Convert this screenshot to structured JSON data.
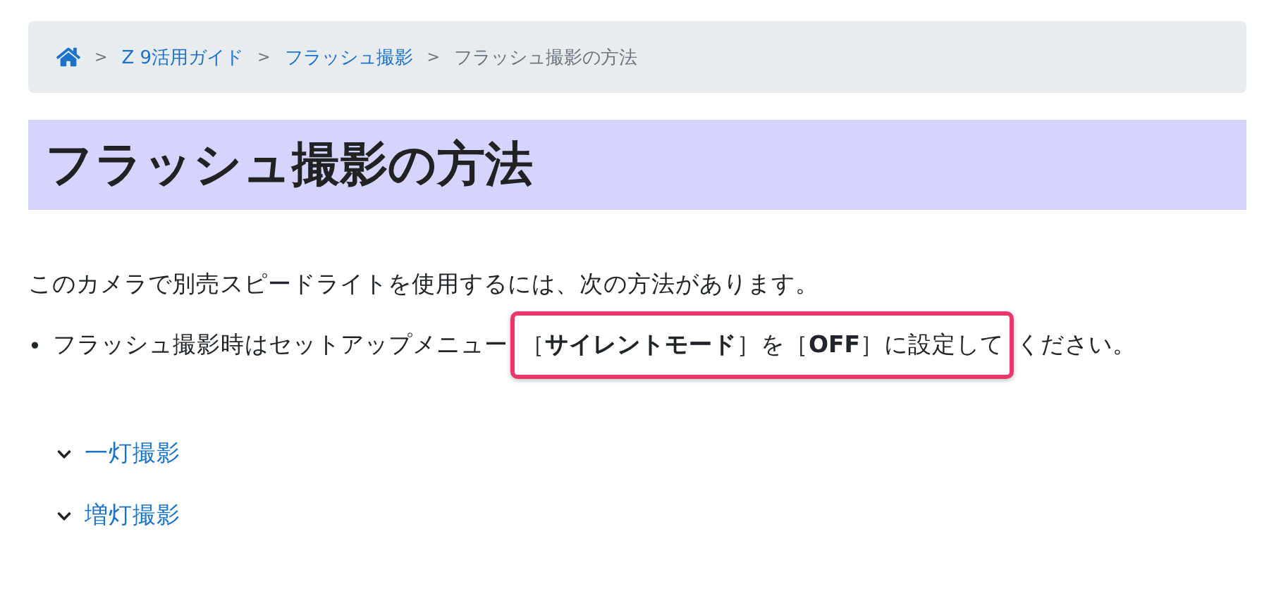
{
  "breadcrumb": {
    "items": [
      {
        "label": "Z 9活用ガイド",
        "link": true
      },
      {
        "label": "フラッシュ撮影",
        "link": true
      },
      {
        "label": "フラッシュ撮影の方法",
        "link": false
      }
    ],
    "separator": ">"
  },
  "heading": "フラッシュ撮影の方法",
  "intro": "このカメラで別売スピードライトを使用するには、次の方法があります。",
  "bullet": {
    "marker": "•",
    "before": "フラッシュ撮影時はセットアップメニュー",
    "highlighted": "［**サイレントモード**］を［**OFF**］に設定して",
    "after": "ください。"
  },
  "sections": [
    {
      "label": "一灯撮影",
      "expanded": false
    },
    {
      "label": "増灯撮影",
      "expanded": false
    }
  ]
}
